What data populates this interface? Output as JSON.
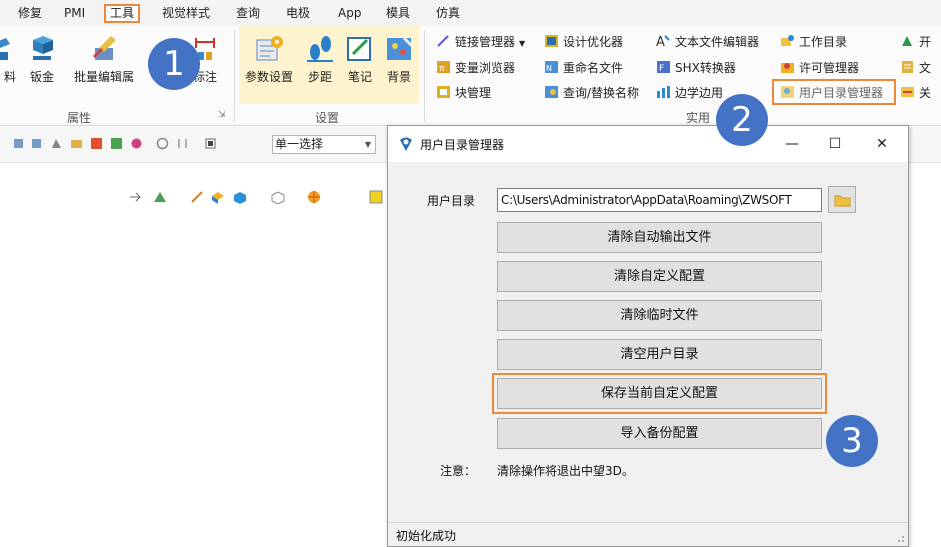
{
  "menubar": {
    "items": [
      "修复",
      "PMI",
      "工具",
      "视觉样式",
      "查询",
      "电极",
      "App",
      "模具",
      "仿真"
    ],
    "active": "工具"
  },
  "ribbon": {
    "left_buttons": [
      "料",
      "钣金",
      "批量编辑属",
      "标注"
    ],
    "attribute_group_label": "属性",
    "settings_buttons": [
      "参数设置",
      "步距",
      "笔记",
      "背景"
    ],
    "settings_group_label": "设置",
    "utility_items": [
      "链接管理器",
      "设计优化器",
      "文本文件编辑器",
      "工作目录",
      "开",
      "变量浏览器",
      "重命名文件",
      "SHX转换器",
      "许可管理器",
      "文",
      "块管理",
      "查询/替换名称",
      "边学边用",
      "用户目录管理器",
      "关"
    ],
    "utility_group_label": "实用"
  },
  "toolbar2": {
    "select_value": "单一选择"
  },
  "badges": [
    "1",
    "2",
    "3"
  ],
  "dialog": {
    "title": "用户目录管理器",
    "dir_label": "用户目录",
    "dir_value": "C:\\Users\\Administrator\\AppData\\Roaming\\ZWSOFT",
    "buttons": [
      "清除自动输出文件",
      "清除自定义配置",
      "清除临时文件",
      "清空用户目录",
      "保存当前自定义配置",
      "导入备份配置"
    ],
    "note_label": "注意：",
    "note_text": "清除操作将退出中望3D。",
    "status": "初始化成功"
  },
  "colors": {
    "highlight": "#ee8838",
    "badge": "#4472c4",
    "settings_bg": "#fdf3cf"
  }
}
